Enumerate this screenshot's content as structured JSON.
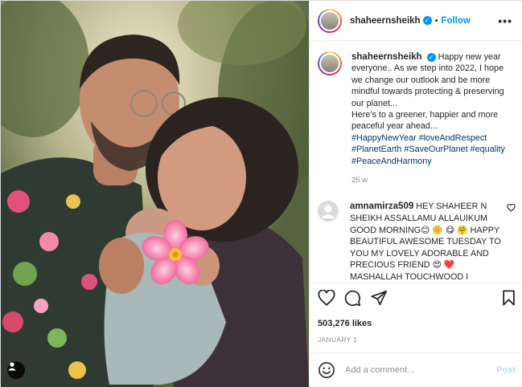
{
  "post": {
    "username": "shaheernsheikh",
    "verified_icon": "verified-badge-icon",
    "separator": "•",
    "follow_label": "Follow",
    "more_icon": "more-options-icon"
  },
  "caption": {
    "username": "shaheernsheikh",
    "text_line1": "Happy new year everyone.. As we step into 2022, I hope we change our outlook and be more mindful towards protecting & preserving our planet...",
    "text_line2": "Here's to a greener, happier and more peaceful year ahead...",
    "hashtags": [
      "#HappyNewYear",
      "#loveAndRespect",
      "#PlanetEarth",
      "#SaveOurPlanet",
      "#equality",
      "#PeaceAndHarmony"
    ],
    "time": "25 w"
  },
  "comment": {
    "username": "amnamirza509",
    "text": "HEY SHAHEER N SHEIKH ASSALLAMU ALLAUIKUM GOOD MORNING😊 🌼 😋 🤗 HAPPY BEAUTIFUL AWESOME TUESDAY TO YOU MY LOVELY ADORABLE AND PRECIOUS FRIEND 😍 ❤️ MASHALLAH TOUCHWOOD I"
  },
  "actions": {
    "like_icon": "heart-icon",
    "comment_icon": "comment-icon",
    "share_icon": "share-icon",
    "save_icon": "bookmark-icon"
  },
  "likes": "503,276 likes",
  "date": "JANUARY 1",
  "add_comment": {
    "placeholder": "Add a comment...",
    "post_label": "Post"
  },
  "colors": {
    "accent": "#0095f6",
    "hashtag": "#00376b",
    "muted": "#8e8e8e",
    "post_disabled": "#b2dffc"
  }
}
